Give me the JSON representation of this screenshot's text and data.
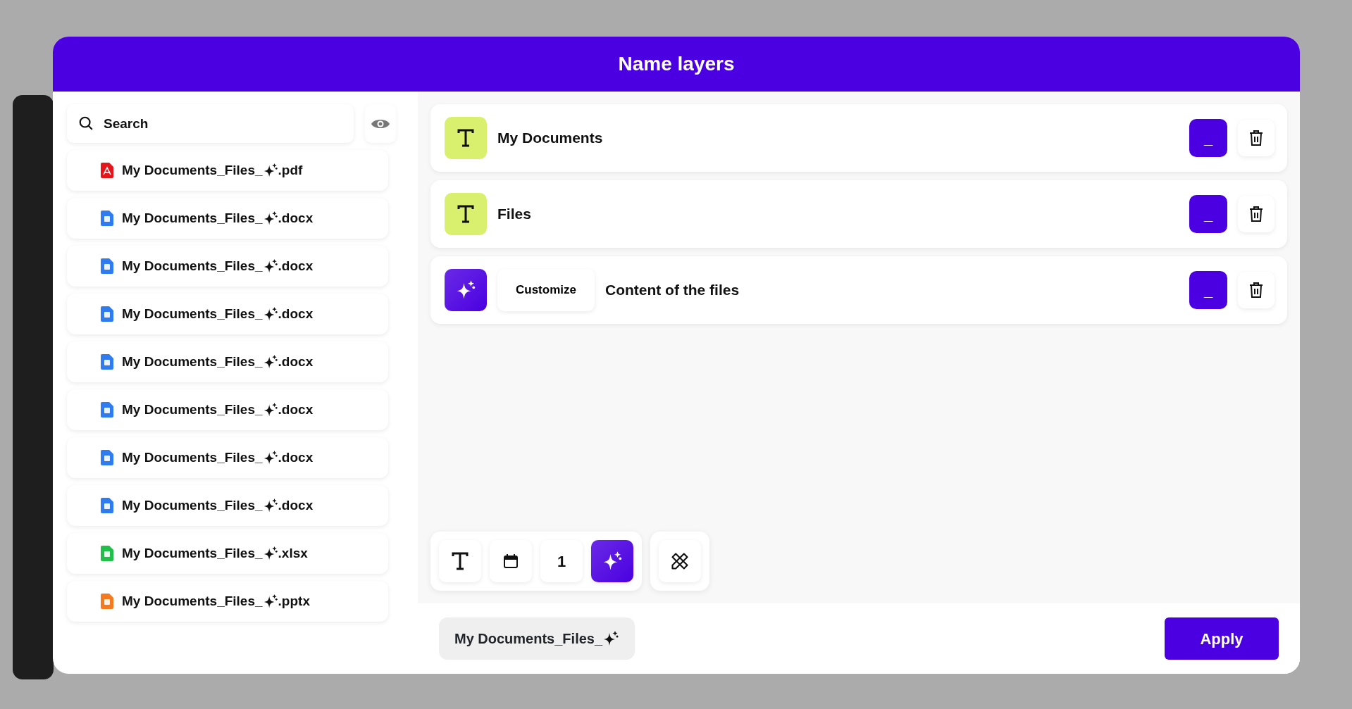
{
  "dialog": {
    "title": "Name layers"
  },
  "search": {
    "placeholder": "Search"
  },
  "files": [
    {
      "kind": "pdf",
      "name": "My Documents_Files_",
      "ext": ".pdf"
    },
    {
      "kind": "word",
      "name": "My Documents_Files_",
      "ext": ".docx"
    },
    {
      "kind": "word",
      "name": "My Documents_Files_",
      "ext": ".docx"
    },
    {
      "kind": "word",
      "name": "My Documents_Files_",
      "ext": ".docx"
    },
    {
      "kind": "word",
      "name": "My Documents_Files_",
      "ext": ".docx"
    },
    {
      "kind": "word",
      "name": "My Documents_Files_",
      "ext": ".docx"
    },
    {
      "kind": "word",
      "name": "My Documents_Files_",
      "ext": ".docx"
    },
    {
      "kind": "word",
      "name": "My Documents_Files_",
      "ext": ".docx"
    },
    {
      "kind": "excel",
      "name": "My Documents_Files_",
      "ext": ".xlsx"
    },
    {
      "kind": "slides",
      "name": "My Documents_Files_",
      "ext": ".pptx"
    }
  ],
  "layers": [
    {
      "kind": "text",
      "label": "My Documents",
      "separator": "_"
    },
    {
      "kind": "text",
      "label": "Files",
      "separator": "_"
    },
    {
      "kind": "ai",
      "button": "Customize",
      "label": "Content of the files",
      "separator": "_"
    }
  ],
  "toolbar": [
    {
      "kind": "text",
      "selected": false
    },
    {
      "kind": "date",
      "selected": false
    },
    {
      "kind": "number",
      "label": "1",
      "selected": false
    },
    {
      "kind": "ai",
      "selected": true
    }
  ],
  "preview": {
    "text": "My Documents_Files_"
  },
  "apply_button": "Apply"
}
